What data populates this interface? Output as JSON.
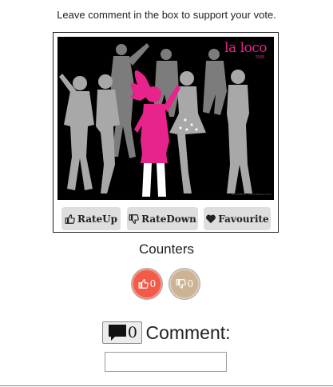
{
  "instruction": "Leave comment in the box to support your vote.",
  "artwork": {
    "brand": "la loco",
    "brand_sub": "2008",
    "watermark": "illustration · www.laloco.com",
    "colors": {
      "background": "#000000",
      "accent": "#e8238b",
      "silhouette": "#9a9a9a"
    }
  },
  "buttons": {
    "rate_up": {
      "label": "RateUp",
      "icon": "thumbs-up-icon"
    },
    "rate_down": {
      "label": "RateDown",
      "icon": "thumbs-down-icon"
    },
    "favourite": {
      "label": "Favourite",
      "icon": "heart-icon"
    }
  },
  "counters": {
    "title": "Counters",
    "up": {
      "value": "0",
      "icon": "thumbs-up-icon",
      "color": "#f25b48"
    },
    "down": {
      "value": "0",
      "icon": "thumbs-down-icon",
      "color": "#ccb393"
    }
  },
  "comment": {
    "count": "0",
    "icon": "speech-bubble-icon",
    "label": "Comment:",
    "input_value": "",
    "input_placeholder": ""
  }
}
